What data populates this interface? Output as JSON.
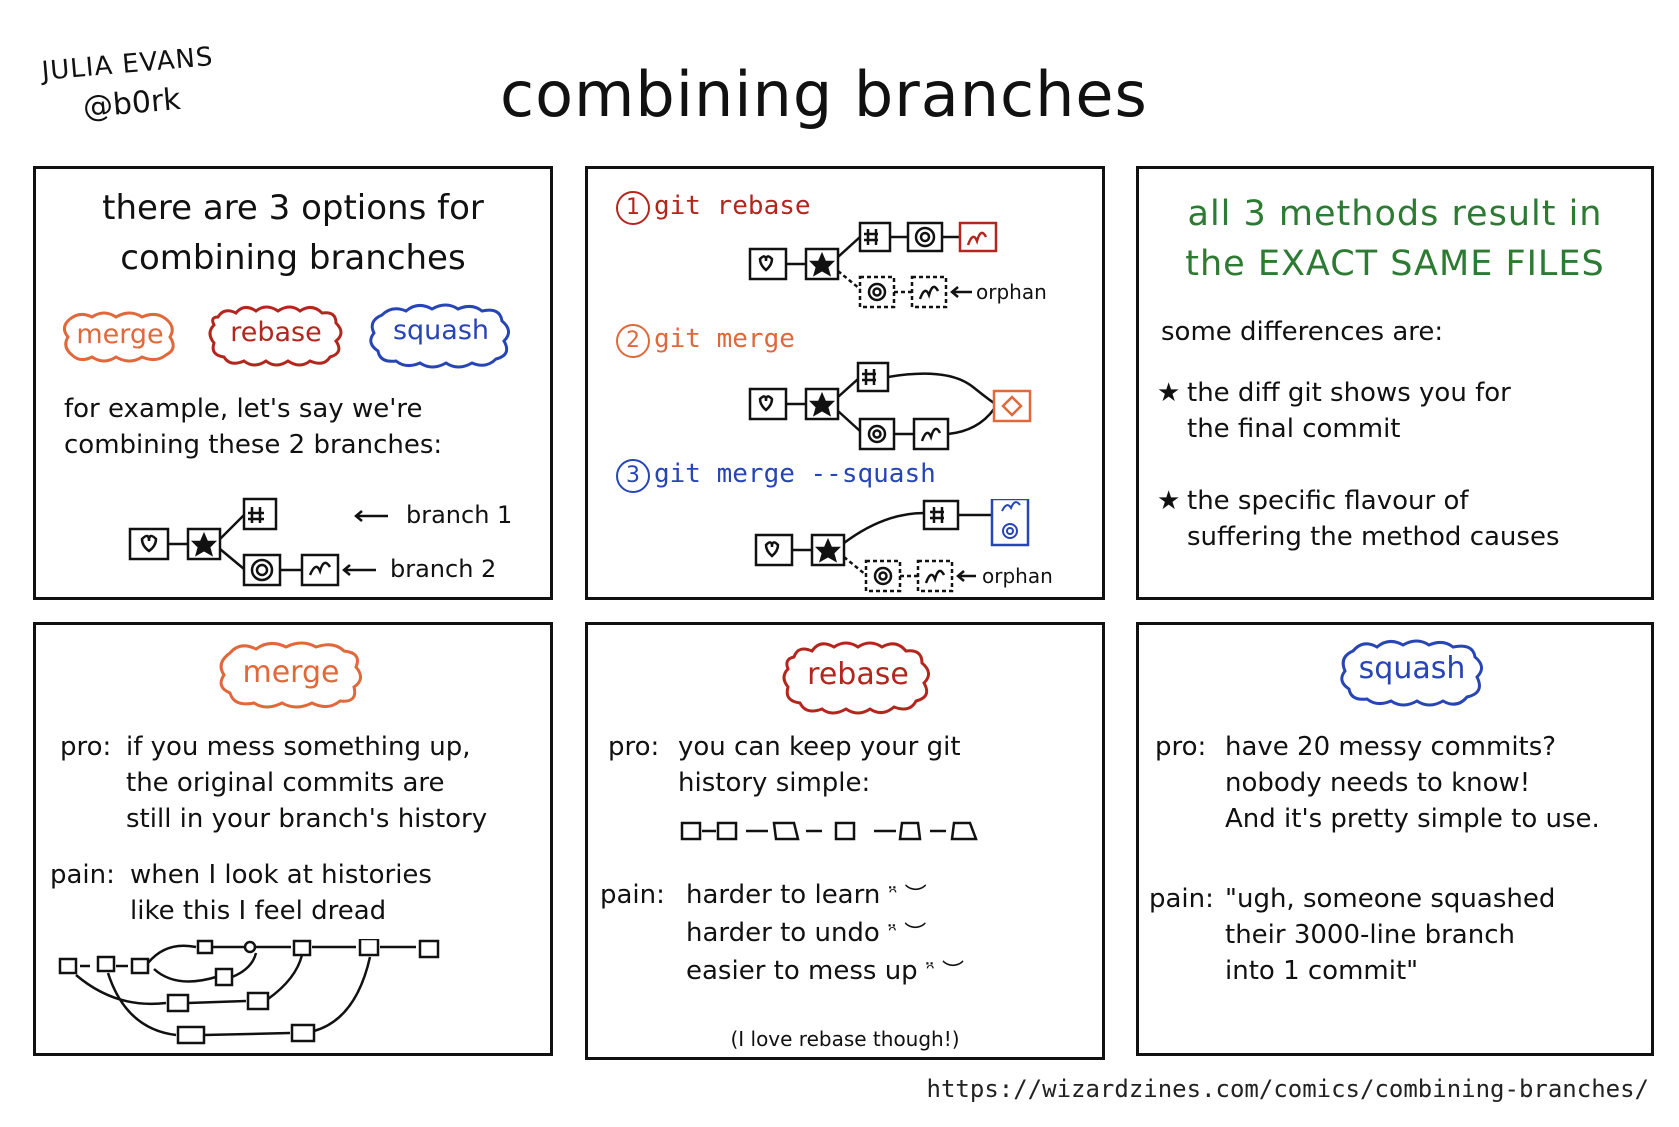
{
  "header": {
    "author_name": "JULIA EVANS",
    "author_handle": "@b0rk",
    "title": "combining branches"
  },
  "colors": {
    "merge": "#e0683a",
    "rebase": "#b3261e",
    "squash": "#2745b5",
    "green": "#2d7a32",
    "ink": "#111111"
  },
  "panel_intro": {
    "heading_line1": "there are 3 options for",
    "heading_line2": "combining branches",
    "badges": [
      "merge",
      "rebase",
      "squash"
    ],
    "example_line1": "for example, let's say we're",
    "example_line2": "combining these 2 branches:",
    "branch1_label": "branch 1",
    "branch2_label": "branch 2"
  },
  "panel_methods": {
    "methods": [
      {
        "number": "1",
        "label": "git rebase",
        "orphan_label": "orphan"
      },
      {
        "number": "2",
        "label": "git merge"
      },
      {
        "number": "3",
        "label": "git merge --squash",
        "orphan_label": "orphan"
      }
    ]
  },
  "panel_same_files": {
    "heading_line1": "all 3 methods result in",
    "heading_line2": "the EXACT SAME FILES",
    "subheading": "some differences are:",
    "bullet_symbol": "★",
    "differences": [
      {
        "line1": "the diff git shows you for",
        "line2": "the final commit"
      },
      {
        "line1": "the specific flavour of",
        "line2": "suffering the method causes"
      }
    ]
  },
  "panel_merge": {
    "badge": "merge",
    "pro_label": "pro:",
    "pro_lines": [
      "if you mess something up,",
      "the original commits are",
      "still in your branch's history"
    ],
    "pain_label": "pain:",
    "pain_lines": [
      "when I look at histories",
      "like this I feel dread"
    ]
  },
  "panel_rebase": {
    "badge": "rebase",
    "pro_label": "pro:",
    "pro_lines": [
      "you can keep your git",
      "history simple:"
    ],
    "pain_label": "pain:",
    "pain_lines": [
      "harder to learn",
      "harder to undo",
      "easier to mess up"
    ],
    "footnote": "(I love rebase though!)"
  },
  "panel_squash": {
    "badge": "squash",
    "pro_label": "pro:",
    "pro_lines": [
      "have 20 messy commits?",
      "nobody needs to know!",
      "And it's pretty simple to use."
    ],
    "pain_label": "pain:",
    "pain_lines": [
      "\"ugh, someone squashed",
      "their 3000-line branch",
      "into 1 commit\""
    ]
  },
  "footer": {
    "url": "https://wizardzines.com/comics/combining-branches/"
  }
}
